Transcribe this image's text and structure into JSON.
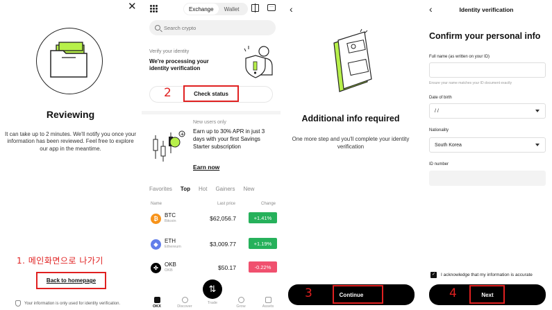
{
  "screen1": {
    "close_glyph": "✕",
    "title": "Reviewing",
    "description": "It can take up to 2 minutes. We'll notify you once your information has been reviewed. Feel free to explore our app in the meantime.",
    "annotation": "1. 메인화면으로 나가기",
    "back_button": "Back to homepage",
    "privacy_note": "Your information is only used for identity verification."
  },
  "screen2": {
    "segment": {
      "active": "Exchange",
      "inactive": "Wallet"
    },
    "search_placeholder": "Search crypto",
    "verify": {
      "label": "Verify your identity",
      "title": "We're processing your identity verification",
      "button": "Check status",
      "annotation": "2"
    },
    "promo": {
      "label": "New users only",
      "text": "Earn up to 30% APR in just 3 days with your first Savings Starter subscription",
      "link": "Earn now"
    },
    "tabs": [
      "Favorites",
      "Top",
      "Hot",
      "Gainers",
      "New"
    ],
    "active_tab": "Top",
    "columns": {
      "name": "Name",
      "price": "Last price",
      "change": "Change"
    },
    "rows": [
      {
        "symbol": "BTC",
        "name": "Bitcoin",
        "price": "$62,056.7",
        "change": "+1.41%",
        "icon": "btc-icon",
        "icon_glyph": "₿",
        "color": "#f7931a",
        "change_color": "#26b15b"
      },
      {
        "symbol": "ETH",
        "name": "Ethereum",
        "price": "$3,009.77",
        "change": "+1.19%",
        "icon": "eth-icon",
        "icon_glyph": "◆",
        "color": "#627eea",
        "change_color": "#26b15b"
      },
      {
        "symbol": "OKB",
        "name": "OKB",
        "price": "$50.17",
        "change": "-0.22%",
        "icon": "okb-icon",
        "icon_glyph": "✜",
        "color": "#000000",
        "change_color": "#f0506e"
      }
    ],
    "nav": [
      "OKX",
      "Discover",
      "Trade",
      "Grow",
      "Assets"
    ],
    "trade_glyph": "⇅"
  },
  "screen3": {
    "back_glyph": "‹",
    "title": "Additional info required",
    "description": "One more step and you'll complete your identity verification",
    "button": "Continue",
    "annotation": "3"
  },
  "screen4": {
    "back_glyph": "‹",
    "header": "Identity verification",
    "title": "Confirm your personal info",
    "fullname_label": "Full name (as written on your ID)",
    "fullname_value": "",
    "fullname_hint": "Ensure your name matches your ID document exactly",
    "dob_label": "Date of birth",
    "dob_value": "/      /",
    "nationality_label": "Nationality",
    "nationality_value": "South Korea",
    "id_label": "ID number",
    "id_value": "",
    "acknowledge": "I acknowledge that my information is accurate",
    "button": "Next",
    "annotation": "4"
  },
  "colors": {
    "accent_green": "#b7f04a",
    "annotation_red": "#e02020",
    "black": "#000000"
  }
}
